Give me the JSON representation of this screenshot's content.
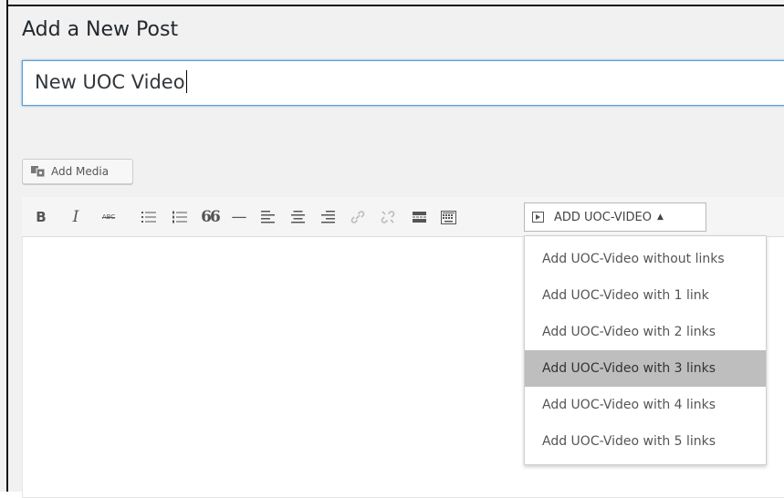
{
  "page": {
    "title": "Add a New Post"
  },
  "post_title": {
    "value": "New UOC Video"
  },
  "media": {
    "add_media_label": "Add Media"
  },
  "toolbar": {
    "buttons": [
      "bold",
      "italic",
      "strikethrough",
      "bulleted-list",
      "numbered-list",
      "blockquote",
      "horizontal-line",
      "align-left",
      "align-center",
      "align-right",
      "insert-link",
      "remove-link",
      "read-more",
      "toolbar-toggle"
    ],
    "bold_glyph": "B",
    "italic_glyph": "I",
    "strike_glyph": "ABC",
    "quote_glyph": "66",
    "hr_glyph": "—",
    "add_video_label": "ADD UOC-VIDEO",
    "add_video_arrow": "▲"
  },
  "dropdown": {
    "items": [
      "Add UOC-Video without links",
      "Add UOC-Video with 1 link",
      "Add UOC-Video with 2 links",
      "Add UOC-Video with 3 links",
      "Add UOC-Video with 4 links",
      "Add UOC-Video with 5 links"
    ],
    "active_index": 3
  },
  "colors": {
    "focus_border": "#5b9dd9",
    "menu_highlight": "#bebebe",
    "toolbar_bg": "#f5f5f5"
  }
}
